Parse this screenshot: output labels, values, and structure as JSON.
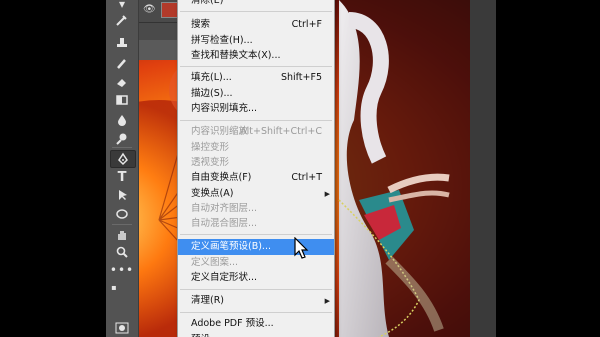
{
  "menu": {
    "items": [
      {
        "label": "清除(E)",
        "state": "normal"
      },
      {
        "label": "搜索",
        "shortcut": "Ctrl+F",
        "state": "normal"
      },
      {
        "label": "拼写检查(H)...",
        "state": "normal"
      },
      {
        "label": "查找和替换文本(X)...",
        "state": "normal"
      },
      {
        "label": "填充(L)...",
        "shortcut": "Shift+F5",
        "state": "normal"
      },
      {
        "label": "描边(S)...",
        "state": "normal"
      },
      {
        "label": "内容识别填充...",
        "state": "normal"
      },
      {
        "label": "内容识别缩放",
        "shortcut": "Alt+Shift+Ctrl+C",
        "state": "disabled"
      },
      {
        "label": "操控变形",
        "state": "disabled"
      },
      {
        "label": "透视变形",
        "state": "disabled"
      },
      {
        "label": "自由变换点(F)",
        "shortcut": "Ctrl+T",
        "state": "normal"
      },
      {
        "label": "变换点(A)",
        "submenu": "▶",
        "state": "normal"
      },
      {
        "label": "自动对齐图层...",
        "state": "disabled"
      },
      {
        "label": "自动混合图层...",
        "state": "disabled"
      },
      {
        "label": "定义画笔预设(B)...",
        "state": "highlighted"
      },
      {
        "label": "定义图案...",
        "state": "disabled"
      },
      {
        "label": "定义自定形状...",
        "state": "normal"
      },
      {
        "label": "清理(R)",
        "submenu": "▶",
        "state": "normal"
      },
      {
        "label": "Adobe PDF 预设...",
        "state": "normal"
      },
      {
        "label": "预设",
        "submenu": "▶",
        "state": "normal"
      }
    ]
  },
  "toolbar": {
    "tools": [
      "eyedropper-icon",
      "stamp-icon",
      "brush-icon",
      "eraser-icon",
      "gradient-icon",
      "blur-icon",
      "dodge-icon",
      "pen-tool-icon",
      "type-tool-icon",
      "path-select-icon",
      "ellipse-tool-icon",
      "hand-tool-icon",
      "zoom-tool-icon",
      "more-tools-icon"
    ],
    "foreground_color": "#f5b800",
    "background_color": "#ffffff"
  },
  "colors": {
    "menu_highlight": "#3f8ef0",
    "toolbar_bg": "#535353"
  }
}
